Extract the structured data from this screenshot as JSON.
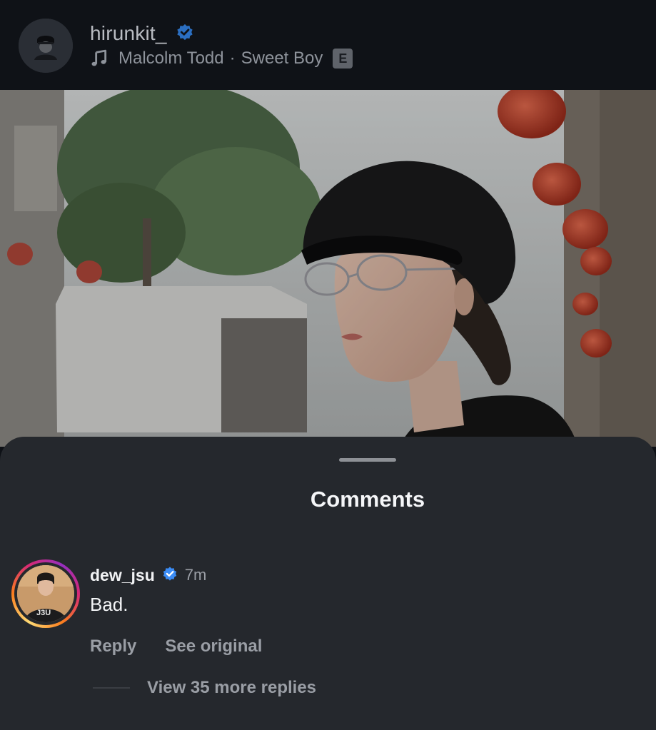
{
  "header": {
    "username": "hirunkit_",
    "verified": true,
    "music": {
      "artist": "Malcolm Todd",
      "separator": "·",
      "song": "Sweet Boy",
      "explicit_label": "E"
    }
  },
  "comments_sheet": {
    "title": "Comments",
    "comments": [
      {
        "username": "dew_jsu",
        "verified": true,
        "time": "7m",
        "text": "Bad.",
        "avatar_shirt_text": "J3U",
        "actions": {
          "reply": "Reply",
          "see_original": "See original"
        },
        "view_replies": "View 35 more replies"
      }
    ]
  },
  "colors": {
    "background": "#0e1116",
    "sheet": "#25282d",
    "verified_blue": "#3b8cf5",
    "muted_text": "#9a9ea5"
  }
}
